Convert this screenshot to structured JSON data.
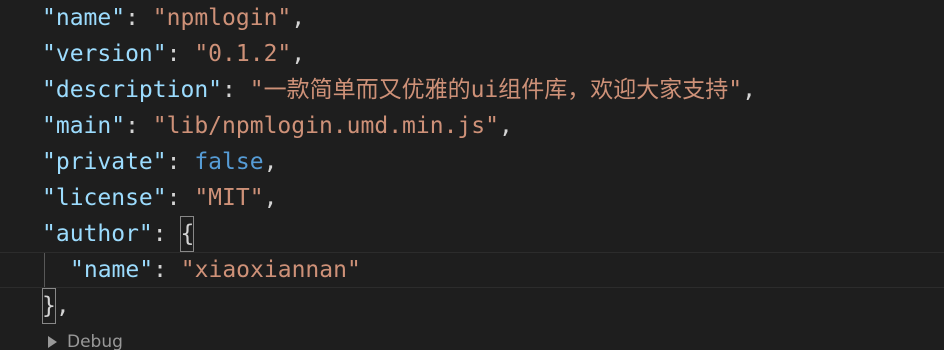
{
  "editor": {
    "lines": [
      {
        "key": "\"name\"",
        "sep": ": ",
        "value": "\"npmlogin\"",
        "trail": ","
      },
      {
        "key": "\"version\"",
        "sep": ": ",
        "value": "\"0.1.2\"",
        "trail": ","
      },
      {
        "key": "\"description\"",
        "sep": ": ",
        "value": "\"一款简单而又优雅的ui组件库，欢迎大家支持\"",
        "trail": ","
      },
      {
        "key": "\"main\"",
        "sep": ": ",
        "value": "\"lib/npmlogin.umd.min.js\"",
        "trail": ","
      },
      {
        "key": "\"private\"",
        "sep": ": ",
        "value": "false",
        "trail": ","
      },
      {
        "key": "\"license\"",
        "sep": ": ",
        "value": "\"MIT\"",
        "trail": ","
      },
      {
        "key": "\"author\"",
        "sep": ": ",
        "open": "{"
      },
      {
        "key": "\"name\"",
        "sep": ": ",
        "value": "\"xiaoxiannan\""
      },
      {
        "close": "}",
        "trail": ","
      }
    ],
    "codelens": {
      "label": "Debug",
      "icon": "play-icon"
    }
  },
  "colors": {
    "background": "#1e1e1e",
    "key": "#9cdcfe",
    "string": "#ce9178",
    "keyword": "#569cd6",
    "punctuation": "#d4d4d4"
  }
}
